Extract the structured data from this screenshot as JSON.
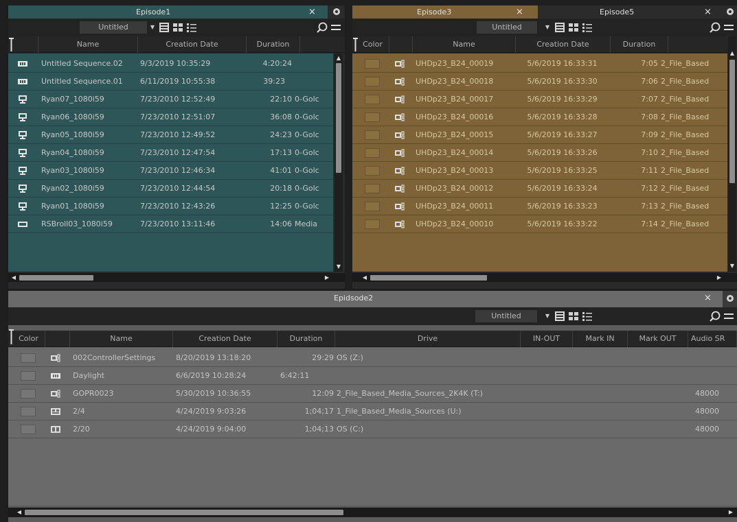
{
  "colors": {
    "teal": "#2e5658",
    "gold": "#7d6337",
    "gray": "#6a6a6a"
  },
  "binA": {
    "tab": {
      "label": "Episode1",
      "close": "×"
    },
    "view": {
      "label": "Untitled"
    },
    "columns": [
      "Name",
      "Creation Date",
      "Duration"
    ],
    "rows": [
      {
        "icon": "sequence-icon",
        "name": "Untitled Sequence.02",
        "date": "9/3/2019 10:35:29",
        "duration": "4:20:24",
        "extra": ""
      },
      {
        "icon": "sequence-icon",
        "name": "Untitled Sequence.01",
        "date": "6/11/2019 10:55:38",
        "duration": "39:23",
        "extra": ""
      },
      {
        "icon": "master-clip-icon",
        "name": "Ryan07_1080i59",
        "date": "7/23/2010 12:52:49",
        "duration": "22:10",
        "extra": "0-Golc"
      },
      {
        "icon": "master-clip-icon",
        "name": "Ryan06_1080i59",
        "date": "7/23/2010 12:51:07",
        "duration": "36:08",
        "extra": "0-Golc"
      },
      {
        "icon": "master-clip-icon",
        "name": "Ryan05_1080i59",
        "date": "7/23/2010 12:49:52",
        "duration": "24:23",
        "extra": "0-Golc"
      },
      {
        "icon": "master-clip-icon",
        "name": "Ryan04_1080i59",
        "date": "7/23/2010 12:47:54",
        "duration": "17:13",
        "extra": "0-Golc"
      },
      {
        "icon": "master-clip-icon",
        "name": "Ryan03_1080i59",
        "date": "7/23/2010 12:46:34",
        "duration": "41:01",
        "extra": "0-Golc"
      },
      {
        "icon": "master-clip-icon",
        "name": "Ryan02_1080i59",
        "date": "7/23/2010 12:44:54",
        "duration": "20:18",
        "extra": "0-Golc"
      },
      {
        "icon": "master-clip-icon",
        "name": "Ryan01_1080i59",
        "date": "7/23/2010 12:43:26",
        "duration": "12:25",
        "extra": "0-Golc"
      },
      {
        "icon": "clip-icon",
        "name": "RSBroll03_1080i59",
        "date": "7/23/2010 13:11:46",
        "duration": "14:06",
        "extra": "Media"
      }
    ]
  },
  "binB": {
    "tabs": [
      {
        "label": "Episode3",
        "close": "×"
      },
      {
        "label": "Episode5",
        "close": "×"
      }
    ],
    "view": {
      "label": "Untitled"
    },
    "columns": [
      "Color",
      "Name",
      "Creation Date",
      "Duration"
    ],
    "rows": [
      {
        "name": "UHDp23_B24_00019",
        "date": "5/6/2019 16:33:31",
        "duration": "7:05",
        "extra": "2_File_Based"
      },
      {
        "name": "UHDp23_B24_00018",
        "date": "5/6/2019 16:33:30",
        "duration": "7:06",
        "extra": "2_File_Based"
      },
      {
        "name": "UHDp23_B24_00017",
        "date": "5/6/2019 16:33:29",
        "duration": "7:07",
        "extra": "2_File_Based"
      },
      {
        "name": "UHDp23_B24_00016",
        "date": "5/6/2019 16:33:28",
        "duration": "7:08",
        "extra": "2_File_Based"
      },
      {
        "name": "UHDp23_B24_00015",
        "date": "5/6/2019 16:33:27",
        "duration": "7:09",
        "extra": "2_File_Based"
      },
      {
        "name": "UHDp23_B24_00014",
        "date": "5/6/2019 16:33:26",
        "duration": "7:10",
        "extra": "2_File_Based"
      },
      {
        "name": "UHDp23_B24_00013",
        "date": "5/6/2019 16:33:25",
        "duration": "7:11",
        "extra": "2_File_Based"
      },
      {
        "name": "UHDp23_B24_00012",
        "date": "5/6/2019 16:33:24",
        "duration": "7:12",
        "extra": "2_File_Based"
      },
      {
        "name": "UHDp23_B24_00011",
        "date": "5/6/2019 16:33:23",
        "duration": "7:13",
        "extra": "2_File_Based"
      },
      {
        "name": "UHDp23_B24_00010",
        "date": "5/6/2019 16:33:22",
        "duration": "7:14",
        "extra": "2_File_Based"
      }
    ]
  },
  "binC": {
    "tab": {
      "label": "Epidsode2",
      "close": "×"
    },
    "view": {
      "label": "Untitled"
    },
    "columns": [
      "Color",
      "Name",
      "Creation Date",
      "Duration",
      "Drive",
      "IN-OUT",
      "Mark IN",
      "Mark OUT",
      "Audio SR"
    ],
    "rows": [
      {
        "icon": "subclip-icon",
        "name": "002ControllerSettings",
        "date": "8/20/2019 13:18:20",
        "duration": "29:29",
        "drive": "OS (Z:)",
        "audio": ""
      },
      {
        "icon": "sequence-icon",
        "name": "Daylight",
        "date": "6/6/2019 10:28:24",
        "duration": "6:42:11",
        "drive": "",
        "audio": ""
      },
      {
        "icon": "subclip-icon",
        "name": "GOPR0023",
        "date": "5/30/2019 10:36:55",
        "duration": "12:09",
        "drive": "2_File_Based_Media_Sources_2K4K (T:)",
        "audio": "48000"
      },
      {
        "icon": "group-clip-icon",
        "name": "2/4",
        "date": "4/24/2019 9:03:26",
        "duration": "1;04;17",
        "drive": "1_File_Based_Media_Sources (U:)",
        "audio": "48000"
      },
      {
        "icon": "multicam-icon",
        "name": "2/20",
        "date": "4/24/2019 9:04:00",
        "duration": "1;04;13",
        "drive": "OS (C:)",
        "audio": "48000"
      }
    ]
  }
}
